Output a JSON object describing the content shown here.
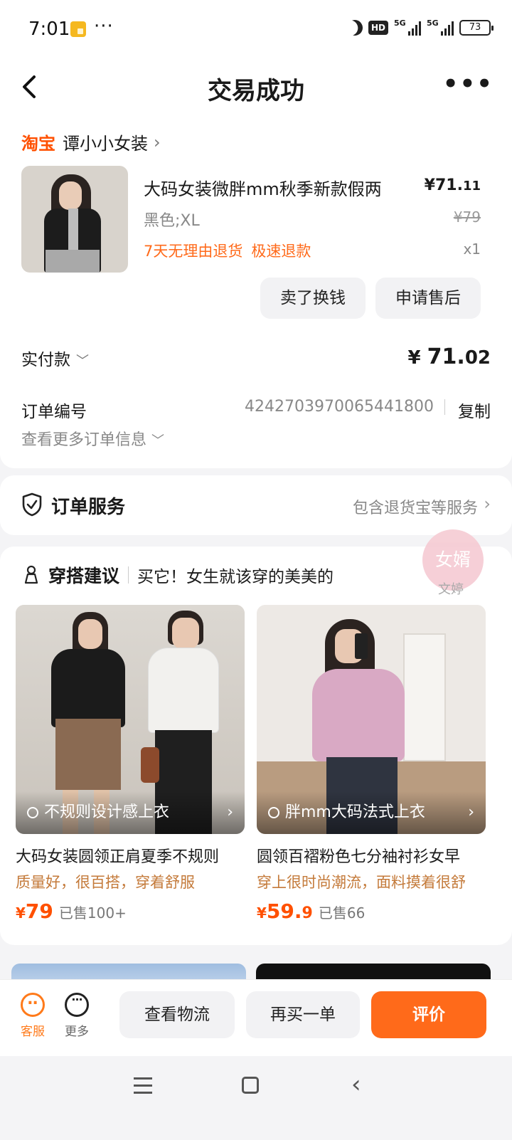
{
  "status_bar": {
    "time": "7:01",
    "dots": "···",
    "hd": "HD",
    "net1": "5G",
    "net2": "5G",
    "battery": "73"
  },
  "header": {
    "title": "交易成功"
  },
  "order": {
    "platform": "淘宝",
    "shop_name": "谭小小女装",
    "product_name": "大码女装微胖mm秋季新款假两",
    "price_int": "¥71.",
    "price_dec": "11",
    "spec": "黑色;XL",
    "original_price": "¥79",
    "tags": [
      "7天无理由退货",
      "极速退款"
    ],
    "quantity": "x1",
    "btn_sell": "卖了换钱",
    "btn_aftersale": "申请售后",
    "paid_label": "实付款",
    "paid_yen": "¥",
    "paid_int": "71.",
    "paid_dec": "02",
    "order_no_label": "订单编号",
    "order_no": "4242703970065441800",
    "copy_label": "复制",
    "more_info": "查看更多订单信息"
  },
  "service": {
    "title": "订单服务",
    "desc": "包含退货宝等服务"
  },
  "recommend": {
    "title": "穿搭建议",
    "subtitle": "买它！女生就该穿的美美的",
    "float_badge": "女婿",
    "float_name": "文婷",
    "products": [
      {
        "search": "不规则设计感上衣",
        "name": "大码女装圆领正肩夏季不规则",
        "desc": "质量好，很百搭，穿着舒服",
        "yen": "¥",
        "price_int": "79",
        "price_dec": "",
        "sold": "已售100+"
      },
      {
        "search": "胖mm大码法式上衣",
        "name": "圆领百褶粉色七分袖衬衫女早",
        "desc": "穿上很时尚潮流，面料摸着很舒",
        "yen": "¥",
        "price_int": "59.",
        "price_dec": "9",
        "sold": "已售66"
      }
    ]
  },
  "bottom_bar": {
    "service_label": "客服",
    "more_label": "更多",
    "logistics": "查看物流",
    "rebuy": "再买一单",
    "review": "评价"
  },
  "colors": {
    "accent": "#ff6a1a",
    "taobao": "#ff5000"
  }
}
